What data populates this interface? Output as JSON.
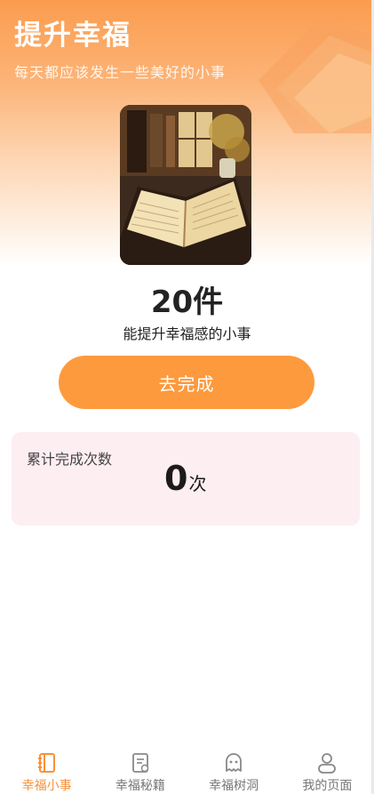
{
  "header": {
    "title": "提升幸福",
    "subtitle": "每天都应该发生一些美好的小事"
  },
  "summary": {
    "count": "20件",
    "description": "能提升幸福感的小事"
  },
  "action": {
    "button_label": "去完成"
  },
  "stats": {
    "label": "累计完成次数",
    "value": "0",
    "unit": "次"
  },
  "tabs": [
    {
      "label": "幸福小事",
      "icon": "notebook-icon",
      "active": true
    },
    {
      "label": "幸福秘籍",
      "icon": "document-icon",
      "active": false
    },
    {
      "label": "幸福树洞",
      "icon": "ghost-icon",
      "active": false
    },
    {
      "label": "我的页面",
      "icon": "profile-icon",
      "active": false
    }
  ],
  "colors": {
    "accent": "#fd9a3d",
    "active_tab": "#f7923a",
    "card_bg": "#fdeef2"
  }
}
